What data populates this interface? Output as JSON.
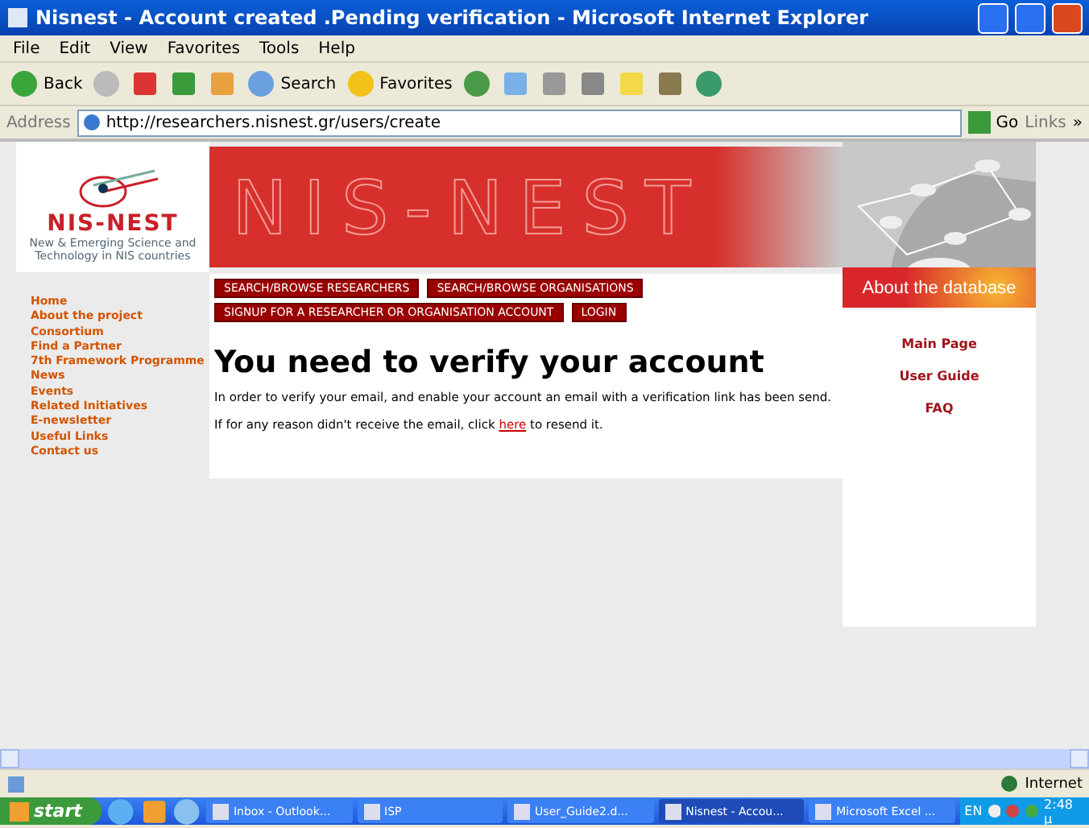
{
  "window": {
    "title": "Nisnest - Account created .Pending verification - Microsoft Internet Explorer"
  },
  "menu": [
    "File",
    "Edit",
    "View",
    "Favorites",
    "Tools",
    "Help"
  ],
  "toolbar": {
    "back": "Back",
    "search": "Search",
    "favorites": "Favorites"
  },
  "address": {
    "label": "Address",
    "url": "http://researchers.nisnest.gr/users/create",
    "go": "Go",
    "links": "Links",
    "more": "»"
  },
  "logo": {
    "name": "NIS-NEST",
    "tagline": "New & Emerging Science and Technology in NIS countries"
  },
  "banner": {
    "text": "NIS-NEST"
  },
  "nav": [
    "Home",
    "About the project",
    "Consortium",
    "Find a Partner",
    "7th Framework Programme",
    "News",
    "Events",
    "Related Initiatives",
    "E-newsletter",
    "Useful Links",
    "Contact us"
  ],
  "action_rows": [
    [
      "SEARCH/BROWSE RESEARCHERS",
      "SEARCH/BROWSE ORGANISATIONS"
    ],
    [
      "SIGNUP FOR A RESEARCHER OR ORGANISATION ACCOUNT",
      "LOGIN"
    ]
  ],
  "heading": "You need to verify your account",
  "message": "In order to verify your email, and enable your account an email with a verification link has been send.",
  "resend": {
    "before": "If for any reason didn't receive the email, click",
    "link": "here",
    "after": "to resend it."
  },
  "about": {
    "title": "About the database",
    "links": [
      "Main Page",
      "User Guide",
      "FAQ"
    ]
  },
  "status": {
    "zone": "Internet"
  },
  "taskbar": {
    "start": "start",
    "tasks": [
      {
        "label": "Inbox - Outlook...",
        "selected": false
      },
      {
        "label": "ISP",
        "selected": false
      },
      {
        "label": "User_Guide2.d...",
        "selected": false
      },
      {
        "label": "Nisnest - Accou...",
        "selected": true
      },
      {
        "label": "Microsoft Excel ...",
        "selected": false
      }
    ],
    "lang": "EN",
    "clock": "2:48 μ"
  }
}
